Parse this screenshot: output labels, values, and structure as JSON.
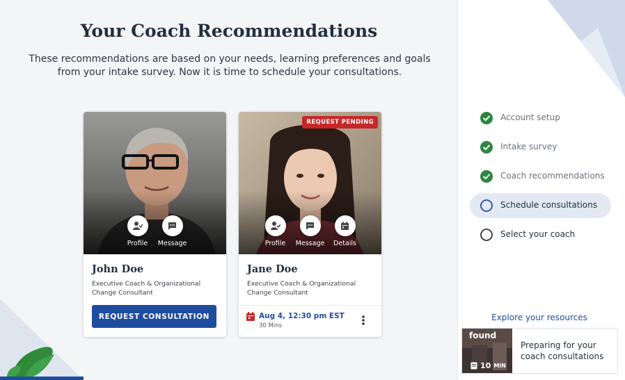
{
  "header": {
    "title": "Your Coach Recommendations",
    "description": "These recommendations are based on your needs, learning preferences and goals from your intake survey. Now it is time to schedule your consultations."
  },
  "coaches": [
    {
      "name": "John Doe",
      "title": "Executive Coach & Organizational Change Consultant",
      "actions": {
        "profile": "Profile",
        "message": "Message"
      },
      "button_label": "REQUEST CONSULTATION",
      "icons": [
        "person-check-icon",
        "chat-icon"
      ]
    },
    {
      "name": "Jane Doe",
      "title": "Executive Coach & Organizational Change Consultant",
      "badge": "REQUEST PENDING",
      "actions": {
        "profile": "Profile",
        "message": "Message",
        "details": "Details"
      },
      "appointment": {
        "date": "Aug 4, 12:30 pm EST",
        "duration": "30 Mins"
      },
      "icons": [
        "person-check-icon",
        "chat-icon",
        "calendar-icon",
        "more-vert-icon"
      ]
    }
  ],
  "steps": [
    {
      "label": "Account setup",
      "status": "done"
    },
    {
      "label": "Intake survey",
      "status": "done"
    },
    {
      "label": "Coach recommendations",
      "status": "done"
    },
    {
      "label": "Schedule consultations",
      "status": "active"
    },
    {
      "label": "Select your coach",
      "status": "todo"
    }
  ],
  "resources": {
    "explore_label": "Explore your resources",
    "item": {
      "title": "Preparing for your coach consultations",
      "time_value": "10",
      "time_unit": "MIN",
      "thumb_text": "found"
    }
  },
  "colors": {
    "primary": "#1f4d9e",
    "success": "#2e8540",
    "badge": "#c62828",
    "active_step_bg": "#e3e9f3"
  }
}
